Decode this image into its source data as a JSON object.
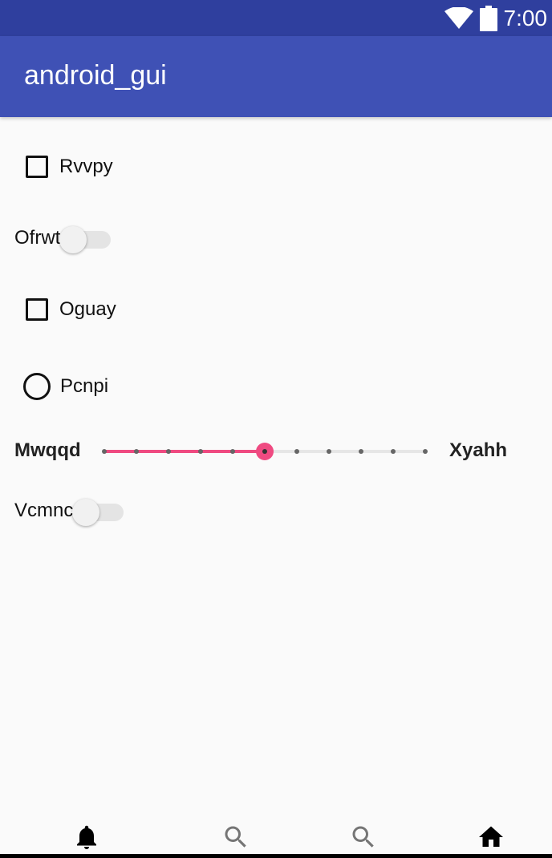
{
  "status_bar": {
    "time": "7:00",
    "background": "#2f3f9e",
    "icons": [
      "wifi-icon",
      "battery-icon"
    ]
  },
  "app_bar": {
    "title": "android_gui",
    "background": "#3f51b5"
  },
  "controls": {
    "checkbox_1": {
      "label": "Rvvpy",
      "checked": false
    },
    "switch_1": {
      "label": "Ofrwt",
      "on": false
    },
    "checkbox_2": {
      "label": "Oguay",
      "checked": false
    },
    "radio_1": {
      "label": "Pcnpi",
      "selected": false
    },
    "slider": {
      "min_label": "Mwqqd",
      "max_label": "Xyahh",
      "steps": 10,
      "value": 5,
      "accent": "#ef4a81"
    },
    "switch_2": {
      "label": "Vcmnc",
      "on": false
    }
  },
  "bottom_nav": {
    "items": [
      {
        "icon": "bell-icon"
      },
      {
        "icon": "search-icon"
      },
      {
        "icon": "search-icon"
      },
      {
        "icon": "home-icon"
      }
    ]
  }
}
